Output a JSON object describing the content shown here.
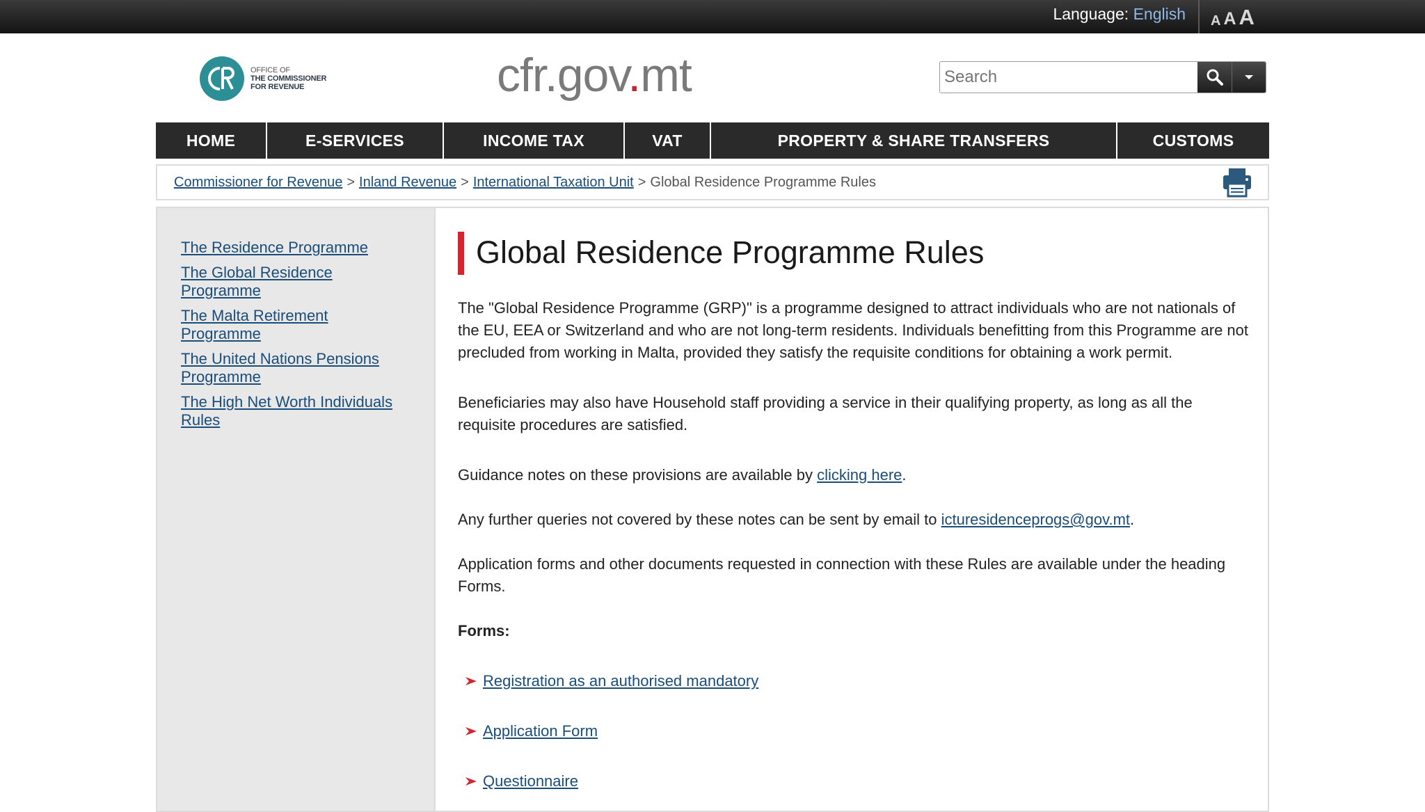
{
  "topbar": {
    "language_label": "Language:",
    "language_value": "English",
    "font_sizes": [
      "A",
      "A",
      "A"
    ]
  },
  "header": {
    "logo_line1": "OFFICE OF",
    "logo_line2": "THE COMMISSIONER",
    "logo_line3": "FOR REVENUE",
    "site_title_a": "cfr",
    "site_title_dot": ".",
    "site_title_b": "gov",
    "site_title_dot2": ".",
    "site_title_c": "mt",
    "search_placeholder": "Search",
    "search_value": "Search"
  },
  "nav": {
    "items": [
      "HOME",
      "E-SERVICES",
      "INCOME TAX",
      "VAT",
      "PROPERTY & SHARE TRANSFERS",
      "CUSTOMS"
    ]
  },
  "breadcrumb": {
    "items": [
      "Commissioner for Revenue",
      "Inland Revenue",
      "International Taxation Unit"
    ],
    "separator": ">",
    "current": "Global Residence Programme Rules"
  },
  "sidebar": {
    "links": [
      "The Residence Programme",
      "The Global Residence Programme",
      "The Malta Retirement Programme",
      "The United Nations Pensions Programme",
      "The High Net Worth Individuals Rules"
    ]
  },
  "main": {
    "title": "Global Residence Programme Rules",
    "p1": "The \"Global Residence Programme (GRP)\" is a programme designed to attract individuals who are not nationals of the EU, EEA or Switzerland and who are not long-term residents. Individuals benefitting from this Programme are not precluded from working in Malta, provided they satisfy the requisite conditions for obtaining a work permit.",
    "p2": "Beneficiaries may also have Household staff providing a service in their qualifying property, as long as all the requisite procedures are satisfied.",
    "p3_prefix": "Guidance notes on these provisions are available by ",
    "p3_link": "clicking here",
    "p3_suffix": ".",
    "p4_prefix": "Any further queries not covered by these notes can be sent by email to ",
    "p4_link": "icturesidenceprogs@gov.mt",
    "p4_suffix": ".",
    "p5": "Application forms and other documents requested in connection with these Rules are available under the heading Forms.",
    "forms_heading": "Forms:",
    "forms": [
      "Registration as an authorised mandatory",
      "Application Form",
      "Questionnaire"
    ]
  },
  "colors": {
    "accent_red": "#d0262f",
    "link_blue": "#1a4d7a",
    "nav_bg": "#2a2a2a",
    "logo_teal": "#2c8f95"
  }
}
